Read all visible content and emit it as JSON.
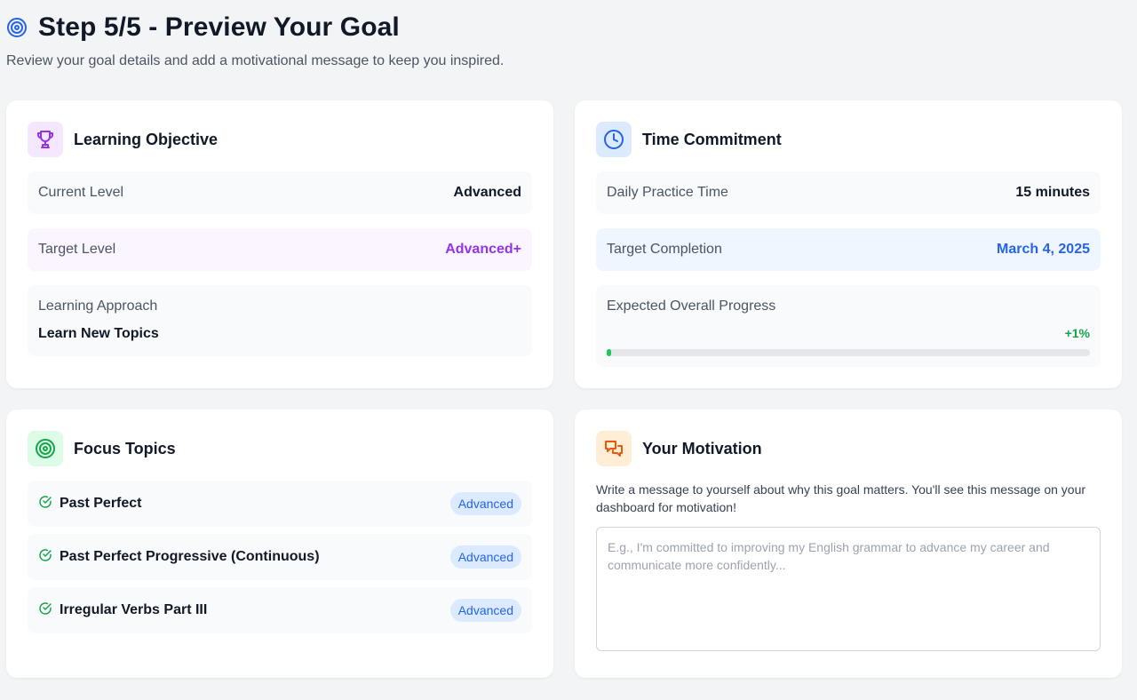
{
  "header": {
    "title": "Step 5/5 - Preview Your Goal",
    "subtitle": "Review your goal details and add a motivational message to keep you inspired."
  },
  "learning_objective": {
    "title": "Learning Objective",
    "icon": "trophy-icon",
    "current_level_label": "Current Level",
    "current_level_value": "Advanced",
    "target_level_label": "Target Level",
    "target_level_value": "Advanced+",
    "approach_label": "Learning Approach",
    "approach_value": "Learn New Topics"
  },
  "time_commitment": {
    "title": "Time Commitment",
    "icon": "clock-icon",
    "daily_label": "Daily Practice Time",
    "daily_value": "15 minutes",
    "completion_label": "Target Completion",
    "completion_value": "March 4, 2025",
    "progress_label": "Expected Overall Progress",
    "progress_delta": "+1%",
    "progress_fraction": 0.01
  },
  "focus_topics": {
    "title": "Focus Topics",
    "icon": "target-icon",
    "items": [
      {
        "name": "Past Perfect",
        "level": "Advanced"
      },
      {
        "name": "Past Perfect Progressive (Continuous)",
        "level": "Advanced"
      },
      {
        "name": "Irregular Verbs Part III",
        "level": "Advanced"
      }
    ]
  },
  "motivation": {
    "title": "Your Motivation",
    "icon": "chat-bubbles-icon",
    "description": "Write a message to yourself about why this goal matters. You'll see this message on your dashboard for motivation!",
    "placeholder": "E.g., I'm committed to improving my English grammar to advance my career and communicate more confidently...",
    "value": ""
  },
  "colors": {
    "accent_purple": "#9333ea",
    "accent_blue": "#2563eb",
    "accent_green": "#16a34a",
    "accent_orange": "#ea580c"
  }
}
